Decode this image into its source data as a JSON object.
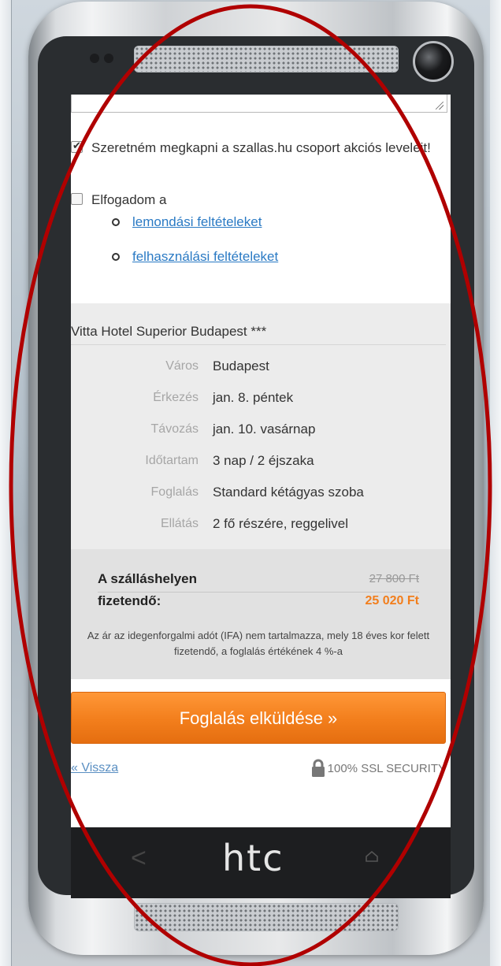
{
  "form": {
    "newsletter_label": "Szeretném megkapni a szallas.hu csoport akciós leveleit!",
    "newsletter_checked": true,
    "accept_label": "Elfogadom a",
    "accept_checked": false,
    "terms": [
      "lemondási feltételeket",
      "felhasználási feltételeket"
    ]
  },
  "hotel": {
    "name": "Vitta Hotel Superior Budapest ***",
    "details": [
      {
        "key": "Város",
        "value": "Budapest"
      },
      {
        "key": "Érkezés",
        "value": "jan. 8. péntek"
      },
      {
        "key": "Távozás",
        "value": "jan. 10. vasárnap"
      },
      {
        "key": "Időtartam",
        "value": "3 nap / 2 éjszaka"
      },
      {
        "key": "Foglalás",
        "value": "Standard kétágyas szoba"
      },
      {
        "key": "Ellátás",
        "value": "2 fő részére, reggelivel"
      }
    ]
  },
  "price": {
    "label": "A szálláshelyen fizetendő:",
    "old": "27 800 Ft",
    "new": "25 020 Ft",
    "tax_note": "Az ár az idegenforgalmi adót (IFA) nem tartalmazza, mely 18 éves kor felett fizetendő, a foglalás értékének 4 %-a"
  },
  "actions": {
    "submit_label": "Foglalás elküldése »",
    "back_label": "« Vissza",
    "ssl_label": "100% SSL SECURITY"
  },
  "device": {
    "brand": "htc",
    "nav_back": "<",
    "nav_home": "home-icon"
  },
  "colors": {
    "accent": "#f27e1c",
    "link": "#2a7ac4",
    "annotation": "#b00000"
  }
}
